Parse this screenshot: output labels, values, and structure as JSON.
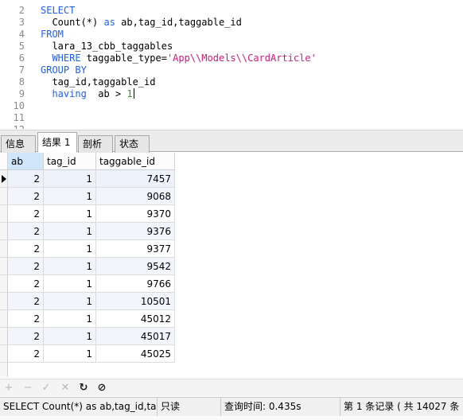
{
  "editor": {
    "lines": [
      {
        "n": "2",
        "tokens": [
          {
            "t": "SELECT",
            "c": "kw"
          }
        ]
      },
      {
        "n": "3",
        "tokens": [
          {
            "t": "  Count(*) ",
            "c": "pl"
          },
          {
            "t": "as",
            "c": "kw"
          },
          {
            "t": " ab,tag_id,taggable_id",
            "c": "pl"
          }
        ]
      },
      {
        "n": "4",
        "tokens": [
          {
            "t": "FROM",
            "c": "kw"
          }
        ]
      },
      {
        "n": "5",
        "tokens": [
          {
            "t": "  lara_13_cbb_taggables",
            "c": "pl"
          }
        ]
      },
      {
        "n": "6",
        "tokens": [
          {
            "t": "  ",
            "c": "pl"
          },
          {
            "t": "WHERE",
            "c": "kw"
          },
          {
            "t": " taggable_type=",
            "c": "pl"
          },
          {
            "t": "'App\\\\Models\\\\CardArticle'",
            "c": "str"
          }
        ]
      },
      {
        "n": "7",
        "tokens": [
          {
            "t": "GROUP BY",
            "c": "kw"
          }
        ]
      },
      {
        "n": "8",
        "tokens": [
          {
            "t": "  tag_id,taggable_id",
            "c": "pl"
          }
        ]
      },
      {
        "n": "9",
        "tokens": [
          {
            "t": "  ",
            "c": "pl"
          },
          {
            "t": "having",
            "c": "kw"
          },
          {
            "t": "  ab > ",
            "c": "pl"
          },
          {
            "t": "1",
            "c": "num"
          }
        ],
        "cursor": true
      },
      {
        "n": "10",
        "tokens": []
      },
      {
        "n": "11",
        "tokens": []
      },
      {
        "n": "12",
        "tokens": []
      }
    ]
  },
  "tabs": [
    {
      "label": "信息",
      "active": false
    },
    {
      "label": "结果 1",
      "active": true
    },
    {
      "label": "剖析",
      "active": false
    },
    {
      "label": "状态",
      "active": false
    }
  ],
  "grid": {
    "columns": [
      "ab",
      "tag_id",
      "taggable_id"
    ],
    "rows": [
      [
        "2",
        "1",
        "7457"
      ],
      [
        "2",
        "1",
        "9068"
      ],
      [
        "2",
        "1",
        "9370"
      ],
      [
        "2",
        "1",
        "9376"
      ],
      [
        "2",
        "1",
        "9377"
      ],
      [
        "2",
        "1",
        "9542"
      ],
      [
        "2",
        "1",
        "9766"
      ],
      [
        "2",
        "1",
        "10501"
      ],
      [
        "2",
        "1",
        "45012"
      ],
      [
        "2",
        "1",
        "45017"
      ],
      [
        "2",
        "1",
        "45025"
      ]
    ]
  },
  "toolbar": {
    "buttons": [
      {
        "glyph": "+",
        "name": "add-record-icon",
        "enabled": false
      },
      {
        "glyph": "−",
        "name": "delete-record-icon",
        "enabled": false
      },
      {
        "glyph": "✓",
        "name": "apply-changes-icon",
        "enabled": false
      },
      {
        "glyph": "✕",
        "name": "discard-changes-icon",
        "enabled": false
      },
      {
        "glyph": "↻",
        "name": "refresh-icon",
        "enabled": true
      },
      {
        "glyph": "⊘",
        "name": "stop-icon",
        "enabled": true
      }
    ]
  },
  "status": {
    "query": "SELECT   Count(*) as ab,tag_id,ta",
    "mode": "只读",
    "query_time": "查询时间: 0.435s",
    "record": "第 1 条记录 ( 共 14027 条 )"
  }
}
